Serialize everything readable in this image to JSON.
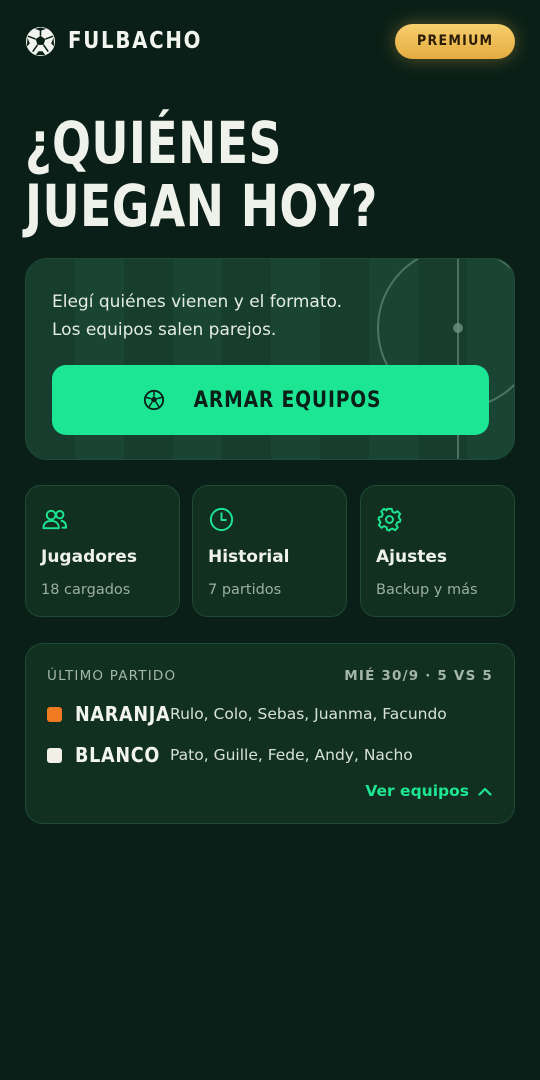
{
  "app": {
    "name": "FULBACHO"
  },
  "header": {
    "premium_label": "PREMIUM"
  },
  "hero": {
    "title_line1": "¿QUIÉNES",
    "title_line2": "JUEGAN HOY?",
    "description_line1": "Elegí quiénes vienen y el formato.",
    "description_line2": "Los equipos salen parejos.",
    "button_label": "ARMAR EQUIPOS"
  },
  "tiles": [
    {
      "title": "Jugadores",
      "subtitle": "18 cargados",
      "icon": "users-icon"
    },
    {
      "title": "Historial",
      "subtitle": "7 partidos",
      "icon": "clock-icon"
    },
    {
      "title": "Ajustes",
      "subtitle": "Backup y más",
      "icon": "gear-icon"
    }
  ],
  "last_match": {
    "label": "ÚLTIMO PARTIDO",
    "meta": "MIÉ 30/9 · 5 VS 5",
    "teams": [
      {
        "name": "NARANJA",
        "color": "#f07a22",
        "players": "Rulo, Colo, Sebas, Juanma, Facundo"
      },
      {
        "name": "BLANCO",
        "color": "#f2f0e6",
        "players": "Pato, Guille, Fede, Andy, Nacho"
      }
    ],
    "toggle_label": "Ver equipos"
  },
  "colors": {
    "background": "#0a1f17",
    "accent": "#1ce693",
    "premium_gold": "#f0be50"
  }
}
